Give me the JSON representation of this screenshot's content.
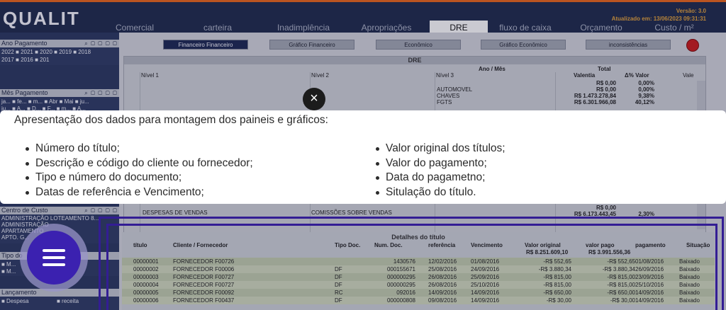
{
  "header": {
    "logo": "QUALIT",
    "version": "Versão: 3.0",
    "updated": "Atualizado em: 13/06/2023 09:31:31",
    "tabs": [
      "Comercial",
      "carteira",
      "Inadimplência",
      "Apropriações",
      "DRE",
      "fluxo de caixa",
      "Orçamento",
      "Custo / m²"
    ],
    "active_tab": "DRE"
  },
  "sidebar": {
    "ano_pagamento": {
      "title": "Ano Pagamento",
      "line1": "2022 ■ 2021 ■ 2020 ■ 2019 ■ 2018",
      "line2": "2017 ■ 2016 ■ 201"
    },
    "mes_pagamento": {
      "title": "Mês Pagamento",
      "line1": "ja... ■ fe... ■ m... ■ Abr ■ Mai ■ ju...",
      "line2": "ju... ■ A... ■ D... ■ F... ■ m... ■ A..."
    },
    "centro_custo": {
      "title": "Centro de Custo",
      "lines": [
        "ADMINISTRAÇÃO LOTEAMENTO 8...",
        "ADMINISTRAÇÃO",
        "APARTAMENTO",
        "APTO. G..."
      ]
    },
    "tipo_doc": {
      "title": "Tipo do",
      "line1": "■ M...",
      "line2": "■ M..."
    },
    "lancamento": {
      "title": "Lançamento",
      "line1": "■ Despesa",
      "line2": "■ receita"
    },
    "icons": "⌕ ▢ ▢ ▢ ▢"
  },
  "subtabs": [
    "Financeiro Financeiro",
    "Gráfico Financeiro",
    "Econômico",
    "Gráfico Econômico",
    "inconsistências"
  ],
  "dre": {
    "title": "DRE",
    "ano_mes": "Ano / Mês",
    "total": "Total",
    "col_nivel1": "Nível 1",
    "col_nivel2": "Nível 2",
    "col_nivel3": "Nível 3",
    "col_valentia": "Valentia",
    "col_pct": "Δ% Valor",
    "col_vale": "Vale",
    "rows": [
      {
        "nivel3": "",
        "valor": "R$ 0,00",
        "pct": "0,00%"
      },
      {
        "nivel3": "AUTOMOVEL",
        "valor": "R$ 0,00",
        "pct": "0,00%"
      },
      {
        "nivel3": "CHAVES",
        "valor": "R$ 1.473.278,84",
        "pct": "9,38%"
      },
      {
        "nivel3": "FGTS",
        "valor": "R$ 6.301.966,08",
        "pct": "40,12%"
      }
    ],
    "bottom_nivel1": "DESPESAS DE VENDAS",
    "bottom_nivel2": "COMISSÕES SOBRE VENDAS",
    "bottom_valor": "R$ 0,00",
    "bottom_valor2": "R$ 6.173.443,45",
    "bottom_pct2": "2,30%"
  },
  "detalhes": {
    "title": "Detalhes do título",
    "headers": [
      "título",
      "Cliente / Fornecedor",
      "Tipo Doc.",
      "Num. Doc.",
      "referência",
      "Vencimento",
      "Valor original",
      "valor pago",
      "pagamento",
      "Situação"
    ],
    "total_original": "R$ 8.251.609,10",
    "total_pago": "R$ 3.991.556,36",
    "rows": [
      [
        "00000001",
        "FORNECEDOR F00726",
        "",
        "1430576",
        "12/02/2016",
        "01/08/2016",
        "-R$ 552,65",
        "-R$ 552,65",
        "01/08/2016",
        "Baixado"
      ],
      [
        "00000002",
        "FORNECEDOR F00006",
        "DF",
        "000155671",
        "25/08/2016",
        "24/09/2016",
        "-R$ 3.880,34",
        "-R$ 3.880,34",
        "26/09/2016",
        "Baixado"
      ],
      [
        "00000003",
        "FORNECEDOR F00727",
        "DF",
        "000000295",
        "26/08/2016",
        "25/09/2016",
        "-R$ 815,00",
        "-R$ 815,00",
        "23/09/2016",
        "Baixado"
      ],
      [
        "00000004",
        "FORNECEDOR F00727",
        "DF",
        "000000295",
        "26/08/2016",
        "25/10/2016",
        "-R$ 815,00",
        "-R$ 815,00",
        "25/10/2016",
        "Baixado"
      ],
      [
        "00000005",
        "FORNECEDOR F00092",
        "RC",
        "092016",
        "14/09/2016",
        "14/09/2016",
        "-R$ 650,00",
        "-R$ 650,00",
        "14/09/2016",
        "Baixado"
      ],
      [
        "00000006",
        "FORNECEDOR F00437",
        "DF",
        "000000808",
        "09/08/2016",
        "14/09/2016",
        "-R$ 30,00",
        "-R$ 30,00",
        "14/09/2016",
        "Baixado"
      ]
    ]
  },
  "tooltip": {
    "title": "Apresentação dos dados para montagem dos paineis e gráficos:",
    "left_items": [
      "Número do título;",
      "Descrição e código do cliente ou fornecedor;",
      "Tipo e número do documento;",
      "Datas de referência e Vencimento;"
    ],
    "right_items": [
      "Valor original dos títulos;",
      "Valor do pagamento;",
      "Data do pagametno;",
      "Situlação do título."
    ],
    "close": "×"
  },
  "colors": {
    "header_bg": "#1f2a4a",
    "accent_orange": "#e0621c",
    "highlight_purple": "#3b21b0",
    "stop_red": "#c21c1c"
  }
}
